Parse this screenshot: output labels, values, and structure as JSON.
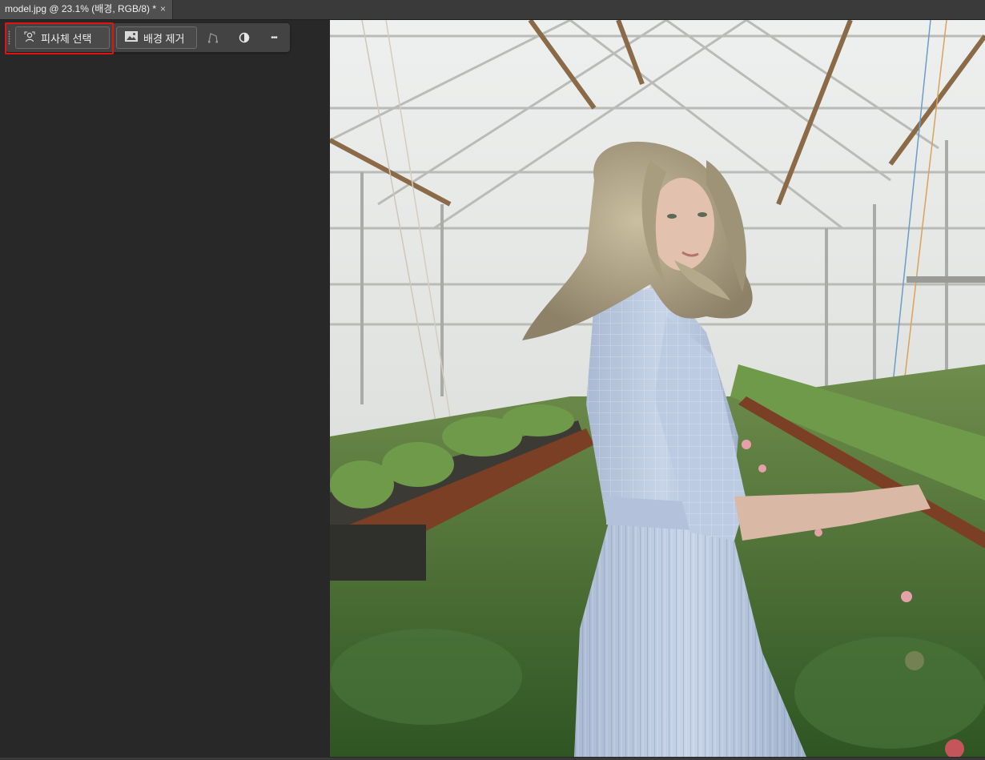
{
  "document_tab": {
    "title": "model.jpg @ 23.1% (배경, RGB/8) *",
    "close_glyph": "×"
  },
  "contextual_taskbar": {
    "select_subject_label": "피사체 선택",
    "select_subject_icon": "person-select-icon",
    "remove_background_label": "배경 제거",
    "remove_background_icon": "image-icon",
    "more_glyph": "•••",
    "icons": [
      "transform-icon",
      "adjustment-circle-icon",
      "more-options-icon"
    ]
  },
  "annotation": {
    "highlight_color": "#e01414",
    "highlighted": "select-subject-button"
  },
  "colors": {
    "workspace_bg": "#282828",
    "toolbar_bg": "#434343",
    "tab_bg": "#505050"
  }
}
